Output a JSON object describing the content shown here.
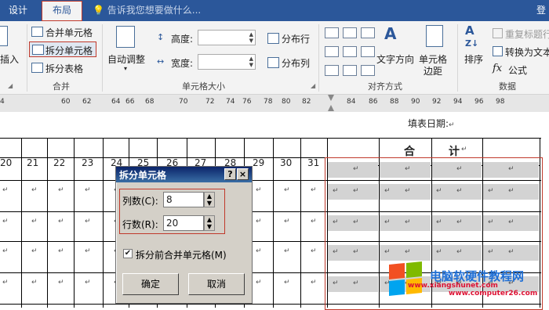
{
  "tabs": {
    "design": "设计",
    "layout": "布局"
  },
  "tell_me": "告诉我您想要做什么...",
  "account": "登",
  "ribbon": {
    "insert": "插入",
    "merge_cells": "合并单元格",
    "split_cells": "拆分单元格",
    "split_table": "拆分表格",
    "merge_group": "合并",
    "autofit": "自动调整",
    "height_label": "高度:",
    "width_label": "宽度:",
    "distribute_rows": "分布行",
    "distribute_cols": "分布列",
    "cell_size_group": "单元格大小",
    "text_direction": "文字方向",
    "cell_margins_1": "单元格",
    "cell_margins_2": "边距",
    "alignment_group": "对齐方式",
    "sort": "排序",
    "repeat_header": "重复标题行",
    "convert_text": "转换为文本",
    "formula": "公式",
    "data_group": "数据"
  },
  "ruler": [
    "4",
    "60",
    "62",
    "64",
    "66",
    "68",
    "70",
    "72",
    "74",
    "76",
    "78",
    "80",
    "82",
    "84",
    "86",
    "88",
    "90",
    "92",
    "94",
    "96",
    "98"
  ],
  "doc": {
    "fill_date": "填表日期:",
    "heji_1": "合",
    "heji_2": "计",
    "day_numbers": [
      "20",
      "21",
      "22",
      "23",
      "24",
      "25",
      "26",
      "27",
      "28",
      "29",
      "30",
      "31"
    ],
    "para_mark": "↵"
  },
  "dialog": {
    "title": "拆分单元格",
    "help": "?",
    "close": "×",
    "cols_label": "列数(C):",
    "cols_value": "8",
    "rows_label": "行数(R):",
    "rows_value": "20",
    "merge_before_label": "拆分前合并单元格(M)",
    "merge_before_checked": "✔",
    "ok": "确定",
    "cancel": "取消"
  },
  "watermark": {
    "line1": "电脑软硬件教程网",
    "line2": "www.computer26.com",
    "line3": "www.xiangshunet.com"
  }
}
